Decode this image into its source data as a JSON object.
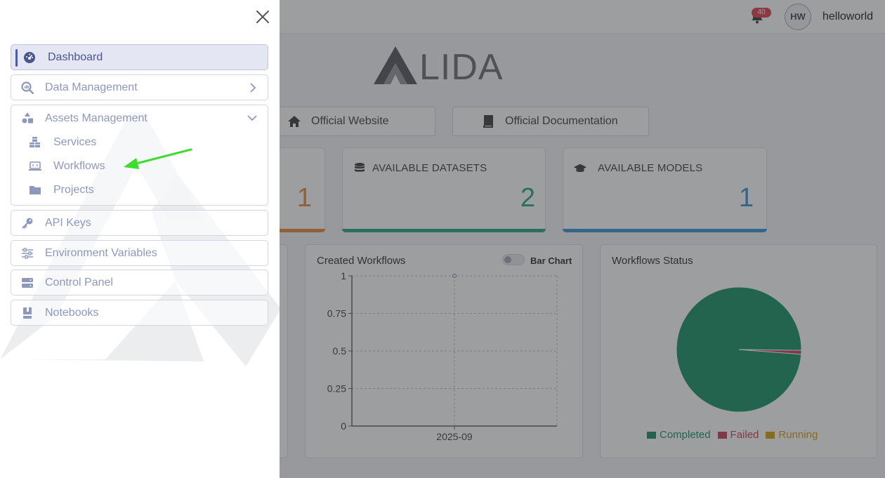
{
  "header": {
    "notifications_count": "40",
    "avatar_initials": "HW",
    "username": "helloworld"
  },
  "brand": {
    "logo_text": "LIDA"
  },
  "links": [
    {
      "label": "Official Website",
      "icon": "home-icon"
    },
    {
      "label": "Official Documentation",
      "icon": "book-icon"
    }
  ],
  "stats": [
    {
      "value": "1",
      "color": "#e8822c"
    },
    {
      "title": "AVAILABLE DATASETS",
      "value": "2",
      "color": "#1aa37a",
      "icon": "database-icon"
    },
    {
      "title": "AVAILABLE MODELS",
      "value": "1",
      "color": "#2d8fd5",
      "icon": "graduation-cap-icon"
    }
  ],
  "workflows_chart": {
    "title": "Created Workflows",
    "toggle_label": "Bar Chart"
  },
  "status_chart": {
    "title": "Workflows Status",
    "legend": [
      {
        "label": "Completed",
        "color": "#0b8a5a"
      },
      {
        "label": "Failed",
        "color": "#c0374e"
      },
      {
        "label": "Running",
        "color": "#cc9a06"
      }
    ]
  },
  "chart_data": [
    {
      "type": "line",
      "title": "Created Workflows",
      "x": [
        "2025-09"
      ],
      "series": [
        {
          "values": [
            1
          ]
        }
      ],
      "ylim": [
        0,
        1
      ],
      "yticks": [
        "0",
        "0.25",
        "0.5",
        "0.75",
        "1"
      ],
      "grid": true
    },
    {
      "type": "pie",
      "title": "Workflows Status",
      "labels": [
        "Completed",
        "Failed",
        "Running"
      ],
      "values": [
        0.99,
        0.01,
        0
      ],
      "legend": "bottom"
    }
  ],
  "drawer": {
    "close_icon": "close-icon",
    "items": [
      {
        "label": "Dashboard",
        "icon": "dashboard-icon",
        "active": true
      },
      {
        "label": "Data Management",
        "icon": "search-chart-icon"
      },
      {
        "label": "Assets Management",
        "icon": "shapes-icon",
        "expanded": true,
        "children": [
          {
            "label": "Services",
            "icon": "cubes-icon"
          },
          {
            "label": "Workflows",
            "icon": "laptop-code-icon"
          },
          {
            "label": "Projects",
            "icon": "folder-icon"
          }
        ]
      },
      {
        "label": "API Keys",
        "icon": "key-icon"
      },
      {
        "label": "Environment Variables",
        "icon": "sliders-icon"
      },
      {
        "label": "Control Panel",
        "icon": "server-icon"
      },
      {
        "label": "Notebooks",
        "icon": "notebook-icon"
      }
    ]
  },
  "annotation": {
    "arrow_color": "#3ddc2f"
  }
}
